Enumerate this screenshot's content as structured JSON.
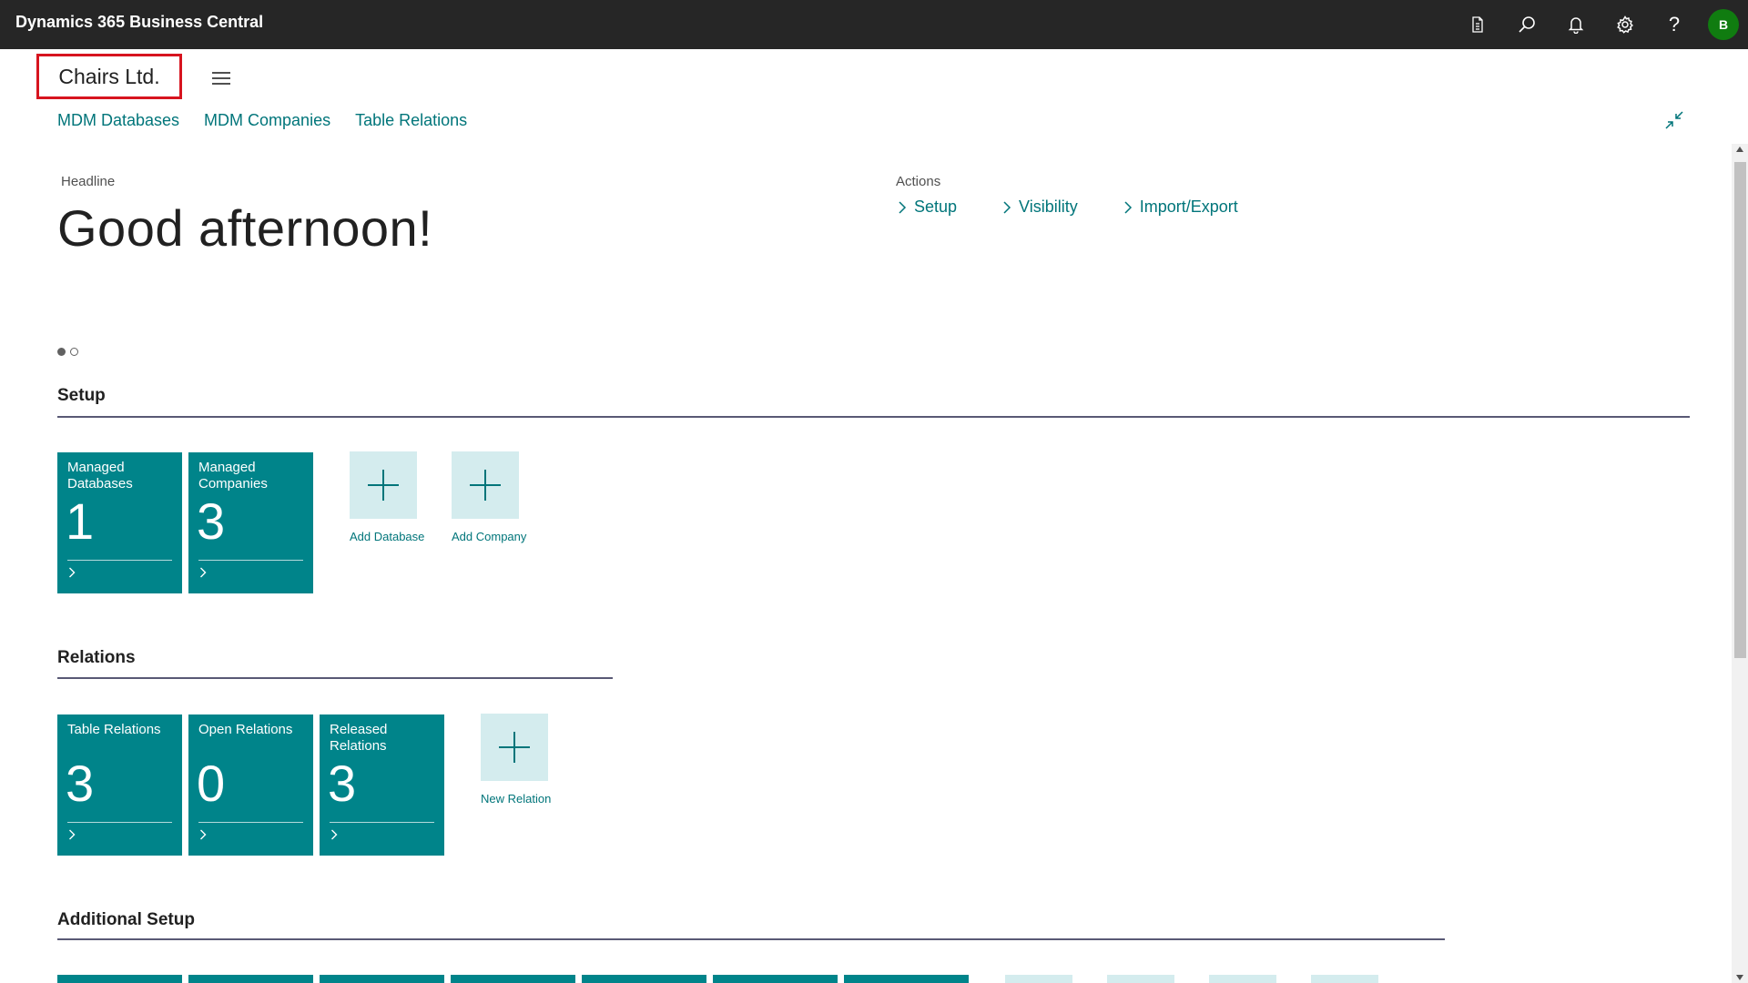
{
  "app": {
    "title": "Dynamics 365 Business Central"
  },
  "topbar": {
    "icons": [
      "document-icon",
      "search-icon",
      "bell-icon",
      "gear-icon",
      "help-icon"
    ],
    "help_glyph": "?",
    "avatar_initial": "B"
  },
  "company": {
    "name": "Chairs Ltd."
  },
  "nav": {
    "links": [
      "MDM Databases",
      "MDM Companies",
      "Table Relations"
    ]
  },
  "headline": {
    "label": "Headline",
    "text": "Good afternoon!"
  },
  "actions": {
    "label": "Actions",
    "items": [
      "Setup",
      "Visibility",
      "Import/Export"
    ]
  },
  "sections": {
    "setup": {
      "title": "Setup",
      "tiles": [
        {
          "label": "Managed Databases",
          "value": "1"
        },
        {
          "label": "Managed Companies",
          "value": "3"
        }
      ],
      "add_tiles": [
        "Add Database",
        "Add Company"
      ]
    },
    "relations": {
      "title": "Relations",
      "tiles": [
        {
          "label": "Table Relations",
          "value": "3"
        },
        {
          "label": "Open Relations",
          "value": "0"
        },
        {
          "label": "Released Relations",
          "value": "3"
        }
      ],
      "add_tiles": [
        "New Relation"
      ]
    },
    "additional_setup": {
      "title": "Additional Setup"
    }
  },
  "colors": {
    "topbar": "#262626",
    "accent": "#00757a",
    "tile": "#00848a",
    "add_tile": "#d4ecee",
    "highlight_border": "#d7141f",
    "avatar": "#107c10"
  }
}
